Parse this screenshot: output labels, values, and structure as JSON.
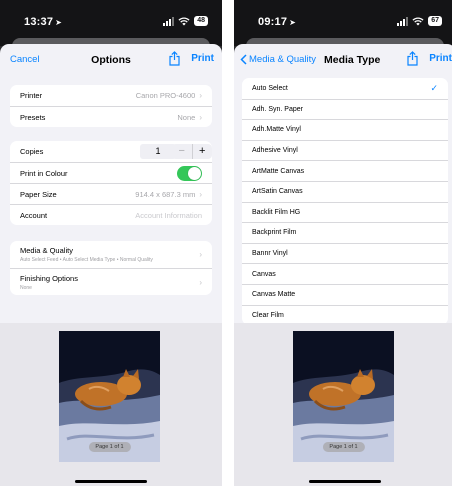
{
  "left": {
    "status": {
      "time": "13:37",
      "battery": "48"
    },
    "nav": {
      "cancel": "Cancel",
      "title": "Options",
      "print": "Print"
    },
    "group1": [
      {
        "label": "Printer",
        "value": "Canon PRO-4600"
      },
      {
        "label": "Presets",
        "value": "None"
      }
    ],
    "copies": {
      "label": "Copies",
      "count": "1",
      "minus": "−",
      "plus": "+"
    },
    "print_colour": {
      "label": "Print in Colour",
      "on": true
    },
    "paper_size": {
      "label": "Paper Size",
      "value": "914.4 x 687.3 mm"
    },
    "account": {
      "label": "Account",
      "placeholder": "Account Information"
    },
    "media_quality": {
      "label": "Media & Quality",
      "sub": "Auto Select Feed • Auto Select Media Type • Normal Quality"
    },
    "finishing": {
      "label": "Finishing Options",
      "sub": "None"
    },
    "preview": {
      "page": "Page 1 of 1"
    }
  },
  "right": {
    "status": {
      "time": "09:17",
      "battery": "67"
    },
    "nav": {
      "back": "Media & Quality",
      "title": "Media Type",
      "print": "Print"
    },
    "media_types": [
      {
        "label": "Auto Select",
        "selected": true
      },
      {
        "label": "Adh. Syn. Paper"
      },
      {
        "label": "Adh.Matte Vinyl"
      },
      {
        "label": "Adhesive Vinyl"
      },
      {
        "label": "ArtMatte Canvas"
      },
      {
        "label": "ArtSatin Canvas"
      },
      {
        "label": "Backlit Film HG"
      },
      {
        "label": "Backprint Film"
      },
      {
        "label": "Bannr Vinyl"
      },
      {
        "label": "Canvas"
      },
      {
        "label": "Canvas Matte"
      },
      {
        "label": "Clear Film"
      }
    ],
    "preview": {
      "page": "Page 1 of 1"
    }
  },
  "icons": {
    "location": "location-arrow-icon",
    "signal": "cellular-signal-icon",
    "wifi": "wifi-icon",
    "battery": "battery-icon",
    "share": "share-icon",
    "chevron": "chevron-right-icon",
    "back": "chevron-left-icon",
    "check": "checkmark-icon"
  },
  "colors": {
    "accent": "#0a84ff",
    "toggle_on": "#34c759",
    "sheet_bg": "#f2f2f7"
  }
}
